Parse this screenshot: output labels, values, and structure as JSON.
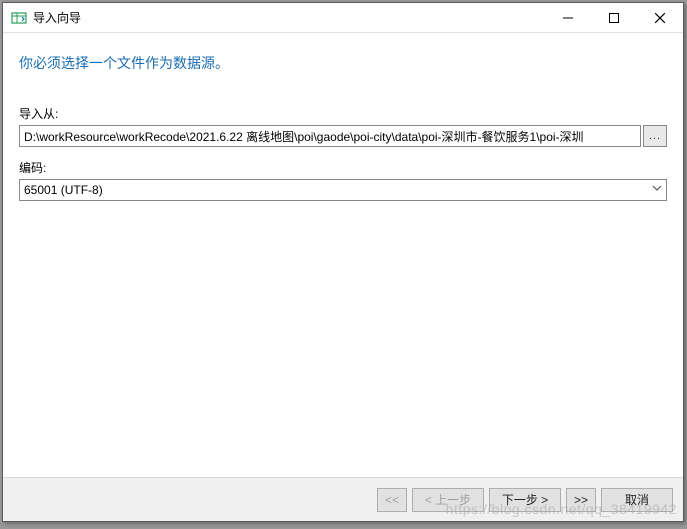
{
  "window": {
    "title": "导入向导"
  },
  "heading": "你必须选择一个文件作为数据源。",
  "importFrom": {
    "label": "导入从:",
    "value": "D:\\workResource\\workRecode\\2021.6.22 离线地图\\poi\\gaode\\poi-city\\data\\poi-深圳市-餐饮服务1\\poi-深圳",
    "browse": "..."
  },
  "encoding": {
    "label": "编码:",
    "value": "65001 (UTF-8)"
  },
  "footer": {
    "first": "<<",
    "prev": "< 上一步",
    "next": "下一步 >",
    "last": ">>",
    "cancel": "取消"
  },
  "watermark": "https://blog.csdn.net/qq_38419942"
}
